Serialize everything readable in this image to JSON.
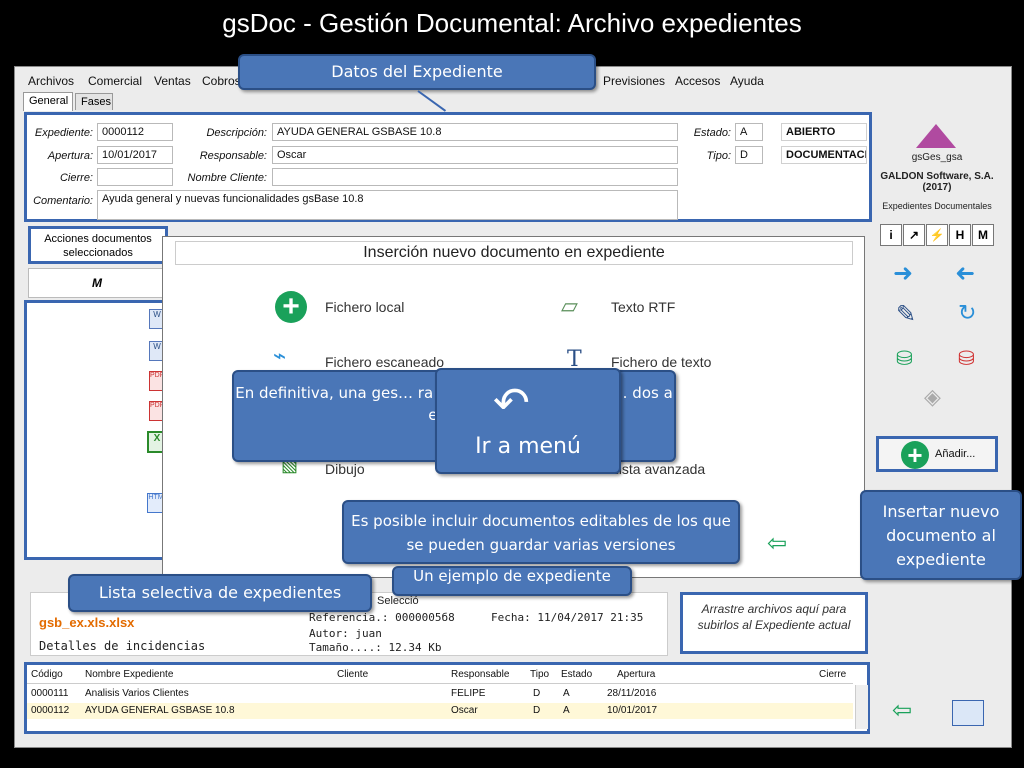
{
  "slide_title": "gsDoc - Gestión Documental: Archivo expedientes",
  "menu": [
    "Archivos",
    "Comercial",
    "Ventas",
    "Cobros",
    "Previsiones",
    "Accesos",
    "Ayuda"
  ],
  "tabs": [
    "General",
    "Fases"
  ],
  "form": {
    "expediente_label": "Expediente:",
    "expediente_value": "0000112",
    "apertura_label": "Apertura:",
    "apertura_value": "10/01/2017",
    "cierre_label": "Cierre:",
    "cierre_value": "",
    "comentario_label": "Comentario:",
    "comentario_value": "Ayuda general y nuevas funcionalidades gsBase 10.8",
    "descripcion_label": "Descripción:",
    "descripcion_value": "AYUDA GENERAL GSBASE 10.8",
    "responsable_label": "Responsable:",
    "responsable_value": "Oscar",
    "cliente_label": "Nombre Cliente:",
    "cliente_value": "",
    "estado_label": "Estado:",
    "estado_code": "A",
    "estado_text": "ABIERTO",
    "tipo_label": "Tipo:",
    "tipo_code": "D",
    "tipo_text": "DOCUMENTACI"
  },
  "actions_label": "Acciones documentos seleccionados",
  "col_m": "M",
  "sidebar": {
    "company_app": "gsGes_gsa",
    "company_name": "GALDON Software, S.A. (2017)",
    "company_sub": "Expedientes Documentales",
    "add_label": "Añadir...",
    "icon_buttons": [
      "i",
      "↗",
      "⚡",
      "H",
      "M"
    ],
    "drop_text": "Arrastre archivos aquí para subirlos al Expediente actual"
  },
  "dialog": {
    "title": "Inserción nuevo documento en expediente",
    "options_left": [
      "Fichero local",
      "Fichero escaneado",
      "Dibujo"
    ],
    "options_right": [
      "Texto RTF",
      "Fichero de texto",
      "Lista avanzada"
    ]
  },
  "preview": {
    "filename": "gsb_ex.xls.xlsx",
    "incidencias": "Detalles de incidencias",
    "selecc": "Selecció",
    "referencia": "Referencia.: 0000005б8",
    "fecha": "Fecha: 11/04/2017 21:35",
    "autor": "Autor: juan",
    "tamano": "Tamaño....: 12.34 Kb"
  },
  "grid": {
    "headers": [
      "Código",
      "Nombre Expediente",
      "Cliente",
      "Responsable",
      "Tipo",
      "Estado",
      "Apertura",
      "Cierre"
    ],
    "rows": [
      [
        "0000111",
        "Analisis Varios Clientes",
        "",
        "FELIPE",
        "D",
        "A",
        "28/11/2016",
        ""
      ],
      [
        "0000112",
        "AYUDA GENERAL GSBASE 10.8",
        "",
        "Oscar",
        "D",
        "A",
        "10/01/2017",
        ""
      ]
    ]
  },
  "callouts": {
    "datos": "Datos del Expediente",
    "definitiva": "En definitiva, una ges… ra tratar sus documentos … dos a expe…",
    "ir_menu": "Ir a menú",
    "editables": "Es posible incluir documentos editables de los que se pueden guardar varias versiones",
    "insertar": "Insertar nuevo documento al expediente",
    "lista": "Lista selectiva de expedientes",
    "ejemplo": "Un ejemplo de expediente"
  },
  "colors": {
    "callout": "#4a76b7",
    "callout_border": "#2b4f86",
    "frame": "#3a66b0",
    "green": "#1aa15a"
  }
}
